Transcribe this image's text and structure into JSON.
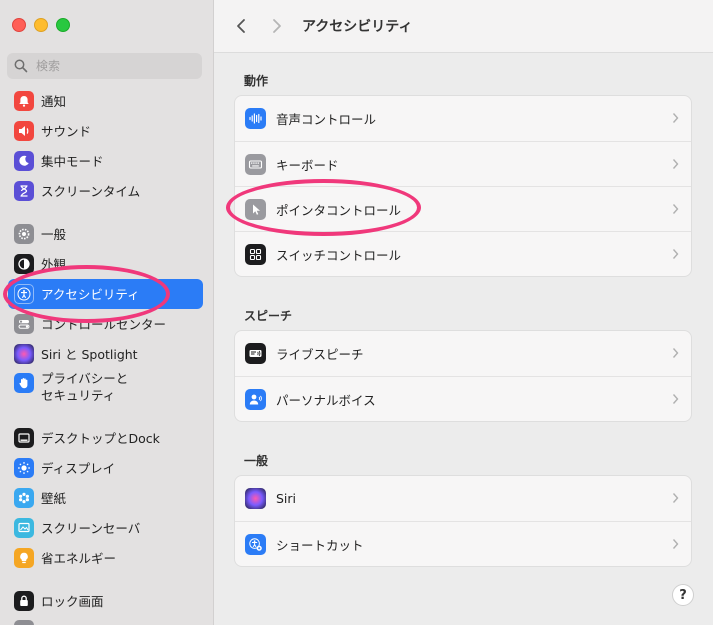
{
  "search": {
    "placeholder": "検索"
  },
  "sidebar": {
    "items": [
      {
        "label": "通知",
        "color": "#f2473f",
        "icon": "bell-icon"
      },
      {
        "label": "サウンド",
        "color": "#f2473f",
        "icon": "speaker-icon"
      },
      {
        "label": "集中モード",
        "color": "#5b4fd6",
        "icon": "moon-icon"
      },
      {
        "label": "スクリーンタイム",
        "color": "#5b4fd6",
        "icon": "hourglass-icon"
      },
      {
        "label": "一般",
        "color": "#8e8e93",
        "icon": "gear-icon"
      },
      {
        "label": "外観",
        "color": "#1c1c1e",
        "icon": "appearance-icon"
      },
      {
        "label": "アクセシビリティ",
        "color": "#2b7cf6",
        "icon": "accessibility-icon"
      },
      {
        "label": "コントロールセンター",
        "color": "#8e8e93",
        "icon": "control-center-icon"
      },
      {
        "label": "Siri と Spotlight",
        "color": "#3b3b8f",
        "icon": "siri-icon"
      },
      {
        "label": "プライバシーと",
        "label2": "セキュリティ",
        "color": "#2b7cf6",
        "icon": "hand-icon"
      },
      {
        "label": "デスクトップとDock",
        "color": "#1c1c1e",
        "icon": "dock-icon"
      },
      {
        "label": "ディスプレイ",
        "color": "#2b7cf6",
        "icon": "display-icon"
      },
      {
        "label": "壁紙",
        "color": "#3aa8f0",
        "icon": "wallpaper-icon"
      },
      {
        "label": "スクリーンセーバ",
        "color": "#3cb8e0",
        "icon": "screensaver-icon"
      },
      {
        "label": "省エネルギー",
        "color": "#f5a623",
        "icon": "lightbulb-icon"
      },
      {
        "label": "ロック画面",
        "color": "#1c1c1e",
        "icon": "lock-icon"
      }
    ],
    "selected_index": 6
  },
  "toolbar": {
    "title": "アクセシビリティ"
  },
  "sections": [
    {
      "title": "動作",
      "rows": [
        {
          "label": "音声コントロール",
          "icon": "waveform-icon",
          "color": "#2b7cf6"
        },
        {
          "label": "キーボード",
          "icon": "keyboard-icon",
          "color": "#9a9a9f"
        },
        {
          "label": "ポインタコントロール",
          "icon": "pointer-icon",
          "color": "#9a9a9f"
        },
        {
          "label": "スイッチコントロール",
          "icon": "switch-grid-icon",
          "color": "#1c1c1e"
        }
      ]
    },
    {
      "title": "スピーチ",
      "rows": [
        {
          "label": "ライブスピーチ",
          "icon": "live-speech-icon",
          "color": "#1c1c1e"
        },
        {
          "label": "パーソナルボイス",
          "icon": "personal-voice-icon",
          "color": "#2b7cf6"
        }
      ]
    },
    {
      "title": "一般",
      "rows": [
        {
          "label": "Siri",
          "icon": "siri-icon",
          "color": "#1c1c1e"
        },
        {
          "label": "ショートカット",
          "icon": "shortcut-icon",
          "color": "#2b7cf6"
        }
      ]
    }
  ],
  "help": {
    "label": "?"
  },
  "colors": {
    "accent": "#2b7cf6",
    "highlight": "#f0387b"
  }
}
